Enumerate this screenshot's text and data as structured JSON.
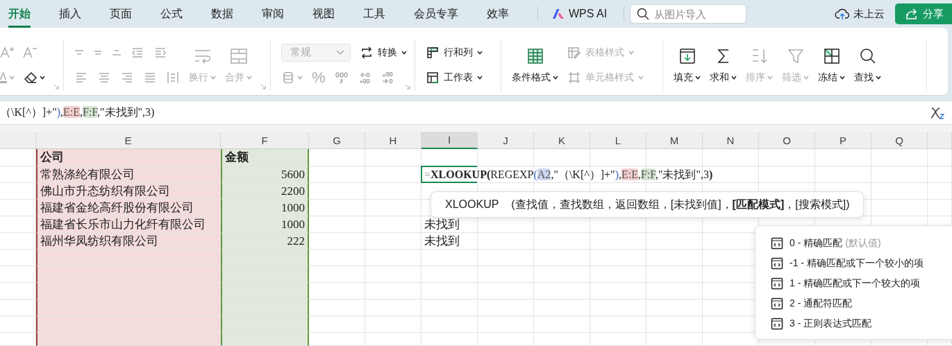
{
  "menu_tabs": [
    {
      "label": "开始",
      "selected": true
    },
    {
      "label": "插入",
      "selected": false
    },
    {
      "label": "页面",
      "selected": false
    },
    {
      "label": "公式",
      "selected": false
    },
    {
      "label": "数据",
      "selected": false
    },
    {
      "label": "审阅",
      "selected": false
    },
    {
      "label": "视图",
      "selected": false
    },
    {
      "label": "工具",
      "selected": false
    },
    {
      "label": "会员专享",
      "selected": false
    },
    {
      "label": "效率",
      "selected": false
    }
  ],
  "ai_button": "WPS AI",
  "search": {
    "placeholder": "从图片导入"
  },
  "cloud_status": "未上云",
  "share_button": "分享",
  "ribbon": {
    "groups": [
      {
        "launcher": true,
        "parts": [
          {
            "kind": "rows",
            "rows": [
              [
                {
                  "kind": "icon",
                  "disabled": true,
                  "dropdown": false
                },
                {
                  "kind": "icon",
                  "disabled": true,
                  "dropdown": false
                }
              ],
              [
                {
                  "kind": "icon",
                  "disabled": true,
                  "dropdown": true
                },
                {
                  "kind": "icon",
                  "disabled": false,
                  "dropdown": true
                }
              ]
            ]
          }
        ]
      },
      {
        "launcher": true,
        "parts": [
          {
            "kind": "rows",
            "rows": [
              [
                {
                  "kind": "icon",
                  "disabled": true,
                  "dropdown": false
                },
                {
                  "kind": "icon",
                  "disabled": true,
                  "dropdown": false
                },
                {
                  "kind": "icon",
                  "disabled": true,
                  "dropdown": false
                },
                {
                  "kind": "icon",
                  "disabled": true,
                  "dropdown": false
                },
                {
                  "kind": "icon",
                  "disabled": true,
                  "dropdown": false
                }
              ],
              [
                {
                  "kind": "icon",
                  "disabled": true,
                  "dropdown": false
                },
                {
                  "kind": "icon",
                  "disabled": true,
                  "dropdown": false
                },
                {
                  "kind": "icon",
                  "disabled": true,
                  "dropdown": false
                },
                {
                  "kind": "icon",
                  "disabled": true,
                  "dropdown": false
                },
                {
                  "kind": "icon",
                  "disabled": true,
                  "dropdown": false
                }
              ]
            ]
          },
          {
            "kind": "big",
            "label": "换行",
            "disabled": true,
            "dropdown": true
          },
          {
            "kind": "big",
            "label": "合并",
            "disabled": true,
            "dropdown": true
          }
        ]
      },
      {
        "launcher": true,
        "parts": [
          {
            "kind": "rows",
            "rows": [
              [
                {
                  "kind": "select",
                  "value": "常规",
                  "disabled": true
                },
                {
                  "kind": "labeled",
                  "label": "转换",
                  "disabled": false,
                  "dropdown": true
                }
              ],
              [
                {
                  "kind": "icon",
                  "disabled": true,
                  "dropdown": true
                },
                {
                  "kind": "glyph",
                  "text": "%",
                  "disabled": true,
                  "dropdown": false
                },
                {
                  "kind": "icon",
                  "disabled": true,
                  "dropdown": false
                },
                {
                  "kind": "icon",
                  "disabled": true,
                  "dropdown": false
                },
                {
                  "kind": "icon",
                  "disabled": true,
                  "dropdown": false
                }
              ]
            ]
          }
        ]
      },
      {
        "launcher": false,
        "parts": [
          {
            "kind": "rows",
            "rows": [
              [
                {
                  "kind": "labeled",
                  "label": "行和列",
                  "disabled": false,
                  "dropdown": true
                }
              ],
              [
                {
                  "kind": "labeled",
                  "label": "工作表",
                  "disabled": false,
                  "dropdown": true
                }
              ]
            ]
          }
        ]
      },
      {
        "launcher": false,
        "parts": [
          {
            "kind": "big",
            "label": "条件格式",
            "disabled": false,
            "dropdown": true
          },
          {
            "kind": "rows",
            "rows": [
              [
                {
                  "kind": "labeled",
                  "label": "表格样式",
                  "disabled": true,
                  "dropdown": true
                }
              ],
              [
                {
                  "kind": "labeled",
                  "label": "单元格样式",
                  "disabled": true,
                  "dropdown": true
                }
              ]
            ]
          }
        ]
      },
      {
        "launcher": false,
        "parts": [
          {
            "kind": "big",
            "label": "填充",
            "disabled": false,
            "dropdown": true
          },
          {
            "kind": "big",
            "label": "求和",
            "disabled": false,
            "dropdown": true
          },
          {
            "kind": "big",
            "label": "排序",
            "disabled": true,
            "dropdown": true
          },
          {
            "kind": "big",
            "label": "筛选",
            "disabled": true,
            "dropdown": true
          },
          {
            "kind": "big",
            "label": "冻结",
            "disabled": false,
            "dropdown": true
          },
          {
            "kind": "big",
            "label": "查找",
            "disabled": false,
            "dropdown": true
          }
        ]
      }
    ]
  },
  "formula_bar": {
    "segments": [
      {
        "kind": "plain",
        "text": "（\\K[^）]+\""
      },
      {
        "kind": "paren",
        "text": ")",
        "color": "#3b63c9"
      },
      {
        "kind": "plain",
        "text": ","
      },
      {
        "kind": "ref",
        "text": "E:E",
        "color": "#f3cdcd"
      },
      {
        "kind": "plain",
        "text": ","
      },
      {
        "kind": "ref",
        "text": "F:F",
        "color": "#d3e3cf"
      },
      {
        "kind": "plain",
        "text": ",\"未找到\",3)"
      }
    ]
  },
  "sheet": {
    "columns": [
      {
        "label": "E",
        "selected": false,
        "color": "#f4dcdc"
      },
      {
        "label": "F",
        "kind": "number",
        "selected": false,
        "color": "#e1e9dc"
      },
      {
        "label": "G",
        "selected": false
      },
      {
        "label": "H",
        "selected": false
      },
      {
        "label": "I",
        "selected": true
      },
      {
        "label": "J",
        "selected": false
      },
      {
        "label": "K",
        "selected": false
      },
      {
        "label": "L",
        "selected": false
      },
      {
        "label": "M",
        "selected": false
      },
      {
        "label": "N",
        "selected": false
      },
      {
        "label": "O",
        "selected": false
      },
      {
        "label": "P",
        "selected": false
      },
      {
        "label": "Q",
        "selected": false
      }
    ],
    "rows": [
      {
        "kind": "header",
        "cells": [
          "公司",
          "金额"
        ]
      },
      {
        "kind": "data",
        "cells": [
          "常熟涤纶有限公司",
          "5600",
          null,
          null,
          {
            "kind": "formula",
            "selected": true,
            "segments": [
              {
                "kind": "dim",
                "text": "="
              },
              {
                "kind": "bold",
                "text": "XLOOKUP("
              },
              {
                "kind": "plain",
                "text": "REGEXP"
              },
              {
                "kind": "paren",
                "text": "(",
                "color": "#3b63c9"
              },
              {
                "kind": "ref",
                "text": "A2",
                "color": "#cdd8f2"
              },
              {
                "kind": "plain",
                "text": ",\"（\\K[^）]+\""
              },
              {
                "kind": "paren",
                "text": ")",
                "color": "#3b63c9"
              },
              {
                "kind": "plain",
                "text": ","
              },
              {
                "kind": "ref",
                "text": "E:E",
                "color": "#f3cdcd"
              },
              {
                "kind": "plain",
                "text": ","
              },
              {
                "kind": "ref",
                "text": "F:F",
                "color": "#d3e3cf"
              },
              {
                "kind": "plain",
                "text": ",\"未找到\",3"
              },
              {
                "kind": "bold",
                "text": ")"
              }
            ]
          }
        ]
      },
      {
        "kind": "data",
        "cells": [
          "佛山市升态纺织有限公司",
          "2200"
        ]
      },
      {
        "kind": "data",
        "cells": [
          "福建省金纶高纤股份有限公司",
          "1000"
        ]
      },
      {
        "kind": "data",
        "cells": [
          "福建省长乐市山力化纤有限公司",
          "1000",
          null,
          null,
          "未找到"
        ]
      },
      {
        "kind": "data",
        "cells": [
          "福州华凤纺织有限公司",
          "222",
          null,
          null,
          "未找到"
        ]
      }
    ]
  },
  "function_tooltip": {
    "name": "XLOOKUP",
    "signature": "(查找值，查找数组，返回数组，[未找到值]，**[匹配模式]**，[搜索模式])"
  },
  "match_mode_options": [
    {
      "label": "0 - 精确匹配",
      "hint": "(默认值)"
    },
    {
      "label": "-1 - 精确匹配或下一个较小的项"
    },
    {
      "label": "1 - 精确匹配或下一个较大的项"
    },
    {
      "label": "2 - 通配符匹配"
    },
    {
      "label": "3 - 正则表达式匹配"
    }
  ]
}
